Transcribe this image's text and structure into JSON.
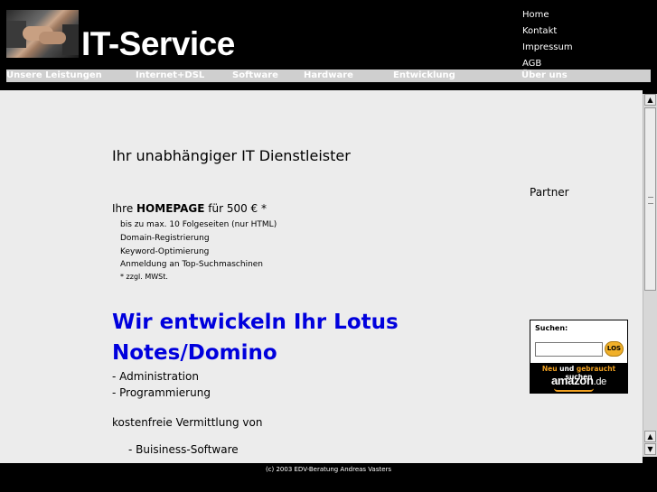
{
  "header": {
    "site_title": "IT-Service",
    "top_links": [
      "Home",
      "Kontakt",
      "Impressum",
      "AGB"
    ]
  },
  "nav": {
    "items": [
      "Unsere Leistungen",
      "Internet+DSL",
      "Software",
      "Hardware",
      "Entwicklung",
      "Über uns"
    ]
  },
  "main": {
    "tagline": "Ihr unabhängiger IT Dienstleister",
    "homepage_offer": {
      "prefix": "Ihre ",
      "highlight": "HOMEPAGE",
      "suffix": " für 500 € *",
      "features": [
        "bis zu max. 10 Folgeseiten (nur HTML)",
        "Domain-Registrierung",
        "Keyword-Optimierung",
        "Anmeldung an Top-Suchmaschinen"
      ],
      "note": "* zzgl. MWSt."
    },
    "lotus": {
      "heading": "Wir entwickeln Ihr Lotus Notes/Domino",
      "items": [
        "- Administration",
        "- Programmierung"
      ]
    },
    "vermittlung": "kostenfreie Vermittlung von",
    "software_item": "- Buisiness-Software"
  },
  "sidebar": {
    "partner": "Partner",
    "amazon": {
      "search_label": "Suchen:",
      "search_value": "",
      "go_label": "LOS",
      "tag_neu": "Neu",
      "tag_und": " und ",
      "tag_gebraucht": "gebraucht",
      "tag_suchen": " suchen",
      "logo_main": "amazon",
      "logo_de": ".de"
    }
  },
  "footer": {
    "text": "(c) 2003 EDV-Beratung Andreas Vasters"
  },
  "colors": {
    "header_bg": "#000000",
    "nav_bg": "#cfcfcf",
    "content_bg": "#ececec",
    "heading_blue": "#0000dd",
    "amazon_orange": "#f0a020"
  }
}
